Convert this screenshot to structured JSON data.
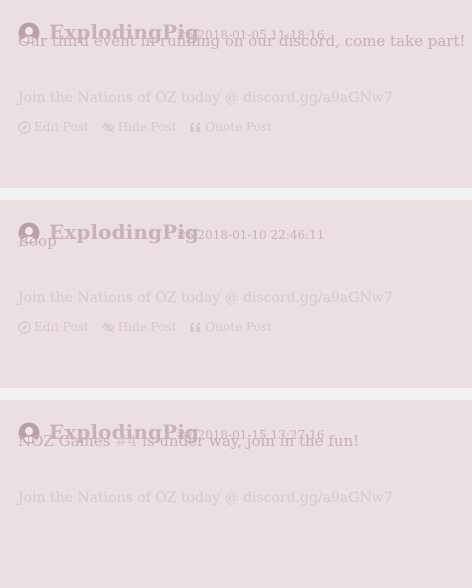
{
  "posts": [
    {
      "author": "ExplodingPig",
      "post_num": "#5",
      "timestamp": "2018-01-05 11:18:16",
      "content": "Our third event in running on our discord, come take part!",
      "signature": "Join the Nations of OZ today @ discord.gg/a9aGNw7",
      "actions": {
        "edit": "Edit Post",
        "hide": "Hide Post",
        "quote": "Quote Post"
      }
    },
    {
      "author": "ExplodingPig",
      "post_num": "#6",
      "timestamp": "2018-01-10 22:46:11",
      "content": "Boop",
      "signature": "Join the Nations of OZ today @ discord.gg/a9aGNw7",
      "actions": {
        "edit": "Edit Post",
        "hide": "Hide Post",
        "quote": "Quote Post"
      }
    },
    {
      "author": "ExplodingPig",
      "post_num": "#7",
      "timestamp": "2018-01-15 13:27:16",
      "content_before": "NOZ Games ",
      "content_link": "#4",
      "content_after": " is under way, join in the fun!",
      "signature": "Join the Nations of OZ today @ discord.gg/a9aGNw7"
    }
  ],
  "icons": {
    "avatar": "user-avatar-icon",
    "edit": "edit-icon",
    "hide": "eye-slash-icon",
    "quote": "quote-icon"
  }
}
